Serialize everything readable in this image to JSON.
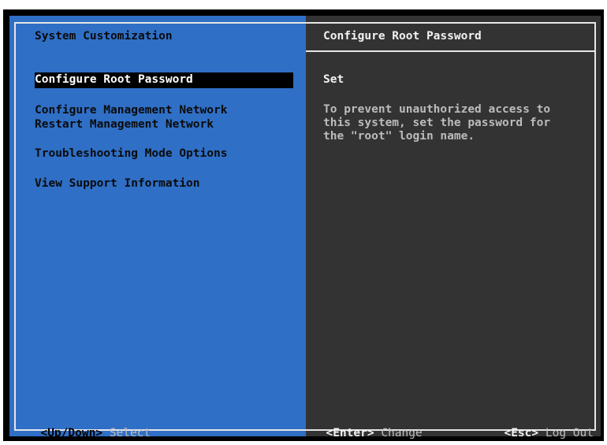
{
  "left_panel": {
    "title": "System Customization",
    "menu": [
      {
        "label": "Configure Root Password",
        "selected": true
      },
      {
        "label": "Configure Management Network",
        "selected": false
      },
      {
        "label": "Restart Management Network",
        "selected": false
      },
      {
        "label": "Troubleshooting Mode Options",
        "selected": false
      },
      {
        "label": "View Support Information",
        "selected": false
      }
    ]
  },
  "right_panel": {
    "title": "Configure Root Password",
    "status": "Set",
    "description": "To prevent unauthorized access to\nthis system, set the password for\nthe \"root\" login name."
  },
  "footer": {
    "left": {
      "key": "<Up/Down>",
      "action": "Select"
    },
    "middle": {
      "key": "<Enter>",
      "action": "Change"
    },
    "right": {
      "key": "<Esc>",
      "action": "Log Out"
    }
  },
  "colors": {
    "left_panel_bg": "#2f6fc6",
    "right_panel_bg": "#333333",
    "frame_bg": "#000000",
    "selection_bg": "#000000",
    "selection_text": "#ffffff"
  }
}
